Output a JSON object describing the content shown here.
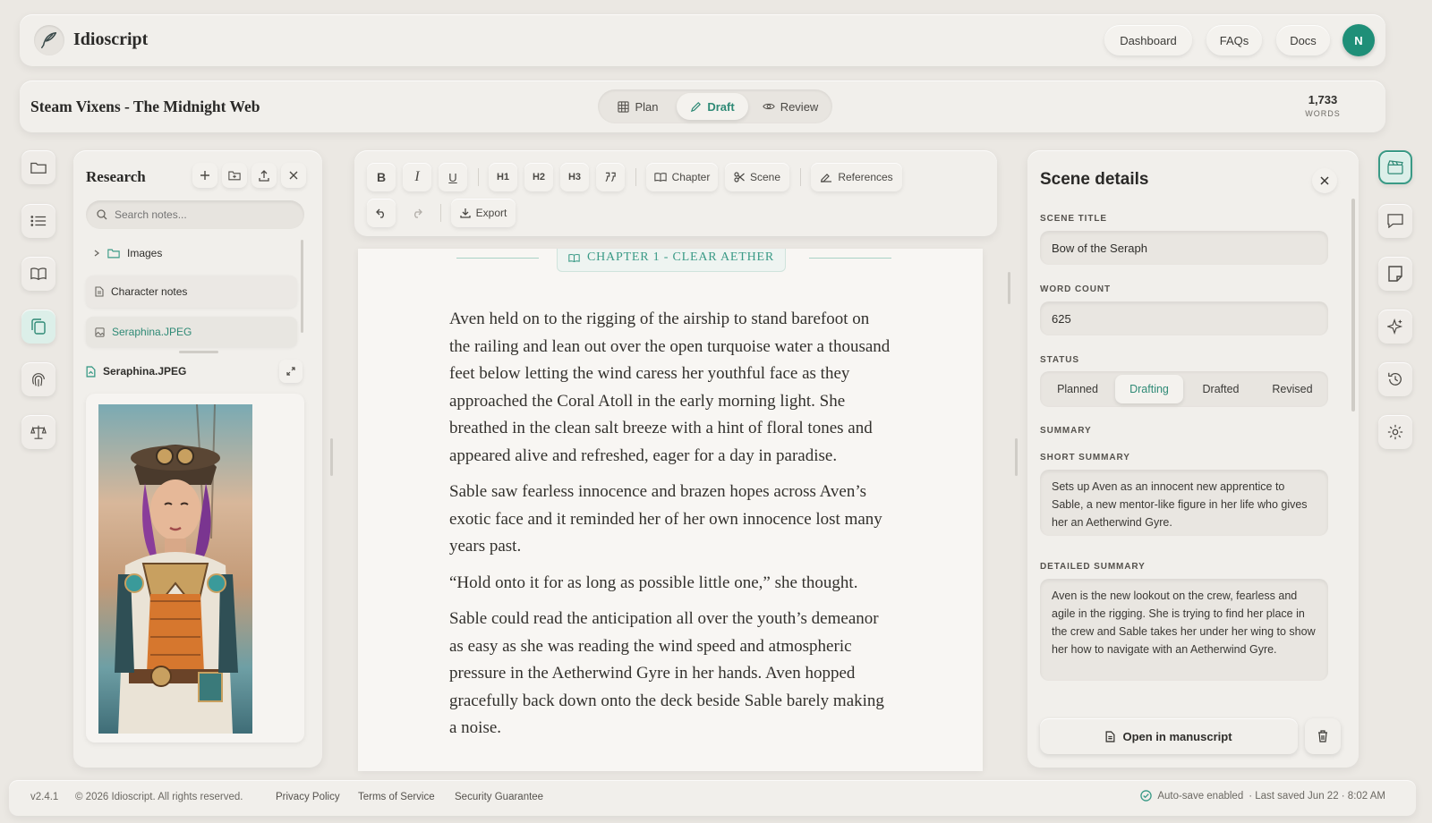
{
  "app": {
    "name": "Idioscript",
    "nav": [
      "Dashboard",
      "FAQs",
      "Docs"
    ],
    "avatar_initial": "N"
  },
  "project": {
    "title": "Steam Vixens - The Midnight Web",
    "modes": [
      "Plan",
      "Draft",
      "Review"
    ],
    "active_mode": "Draft",
    "word_count": "1,733",
    "word_count_label": "WORDS"
  },
  "research": {
    "title": "Research",
    "search_placeholder": "Search notes...",
    "items": [
      {
        "label": "Images",
        "type": "folder"
      },
      {
        "label": "Character notes",
        "type": "document"
      },
      {
        "label": "Seraphina.JPEG",
        "type": "image"
      }
    ],
    "preview_title": "Seraphina.JPEG"
  },
  "toolbar": {
    "bold": "B",
    "italic": "I",
    "underline": "U",
    "h1": "H1",
    "h2": "H2",
    "h3": "H3",
    "chapter": "Chapter",
    "scene": "Scene",
    "references": "References",
    "export": "Export"
  },
  "manuscript": {
    "chapter_heading": "CHAPTER 1 - CLEAR AETHER",
    "paragraphs": [
      "Aven held on to the rigging of the airship to stand barefoot on the railing and lean out over the open turquoise water a thousand feet below letting the wind caress her youthful face as they approached the Coral Atoll in the early morning light. She breathed in the clean salt breeze with a hint of floral tones and appeared alive and refreshed, eager for a day in paradise.",
      "Sable saw fearless innocence and brazen hopes across Aven’s exotic face and it reminded her of her own innocence lost many years past.",
      "“Hold onto it for as long as possible little one,” she thought.",
      "Sable could read the anticipation all over the youth’s demeanor as easy as she was reading the wind speed and atmospheric pressure in the Aetherwind Gyre in her hands. Aven hopped gracefully back down onto the deck beside Sable barely making a noise."
    ]
  },
  "scene_details": {
    "title": "Scene details",
    "scene_title_label": "SCENE TITLE",
    "scene_title": "Bow of the Seraph",
    "word_count_label": "WORD COUNT",
    "word_count": "625",
    "status_label": "STATUS",
    "statuses": [
      "Planned",
      "Drafting",
      "Drafted",
      "Revised"
    ],
    "active_status": "Drafting",
    "summary_label": "SUMMARY",
    "short_summary_label": "SHORT SUMMARY",
    "short_summary": "Sets up Aven as an innocent new apprentice to Sable, a new mentor-like figure in her life who gives her an Aetherwind Gyre.",
    "detailed_summary_label": "DETAILED SUMMARY",
    "detailed_summary": "Aven is the new lookout on the crew, fearless and agile in the rigging. She is trying to find her place in the crew and Sable takes her under her wing to show her how to navigate with an Aetherwind Gyre.",
    "open_button": "Open in manuscript"
  },
  "footer": {
    "version": "v2.4.1",
    "copyright": "© 2026 Idioscript. All rights reserved.",
    "links": [
      "Privacy Policy",
      "Terms of Service",
      "Security Guarantee"
    ],
    "autosave": "Auto-save enabled",
    "last_saved": "· Last saved Jun 22 · 8:02 AM"
  },
  "colors": {
    "accent": "#3a9a86",
    "accent_light": "#dcefe9",
    "avatar": "#1f8f78",
    "background": "#ebe8e3"
  },
  "icons": {
    "left_rail": [
      "folder-icon",
      "list-icon",
      "book-icon",
      "copy-icon",
      "fingerprint-icon",
      "scale-icon"
    ],
    "right_rail": [
      "clapperboard-icon",
      "message-icon",
      "note-icon",
      "sparkle-icon",
      "history-icon",
      "gear-icon"
    ]
  }
}
